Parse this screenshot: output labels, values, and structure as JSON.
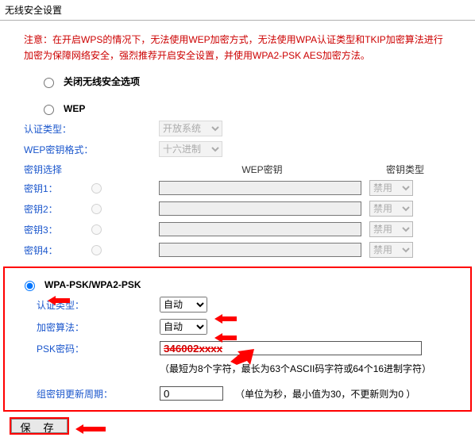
{
  "page_title": "无线安全设置",
  "notice": "注意：在开启WPS的情况下，无法使用WEP加密方式，无法使用WPA认证类型和TKIP加密算法进行加密为保障网络安全，强烈推荐开启安全设置，并使用WPA2-PSK AES加密方法。",
  "options": {
    "disable_label": "关闭无线安全选项",
    "wep_label": "WEP"
  },
  "wep": {
    "auth_label": "认证类型：",
    "auth_value": "开放系统",
    "fmt_label": "WEP密钥格式：",
    "fmt_value": "十六进制",
    "keysel_label": "密钥选择",
    "keycol_label": "WEP密钥",
    "keytype_label": "密钥类型",
    "keys": [
      {
        "label": "密钥1：",
        "type": "禁用"
      },
      {
        "label": "密钥2：",
        "type": "禁用"
      },
      {
        "label": "密钥3：",
        "type": "禁用"
      },
      {
        "label": "密钥4：",
        "type": "禁用"
      }
    ]
  },
  "wpa": {
    "title": "WPA-PSK/WPA2-PSK",
    "auth_label": "认证类型：",
    "auth_value": "自动",
    "enc_label": "加密算法：",
    "enc_value": "自动",
    "psk_label": "PSK密码：",
    "psk_value": "346002xxxx",
    "psk_hint": "（最短为8个字符，最长为63个ASCII码字符或64个16进制字符）",
    "group_label": "组密钥更新周期：",
    "group_value": "0",
    "group_hint": "（单位为秒，最小值为30，不更新则为0 ）"
  },
  "save_btn": "保 存"
}
